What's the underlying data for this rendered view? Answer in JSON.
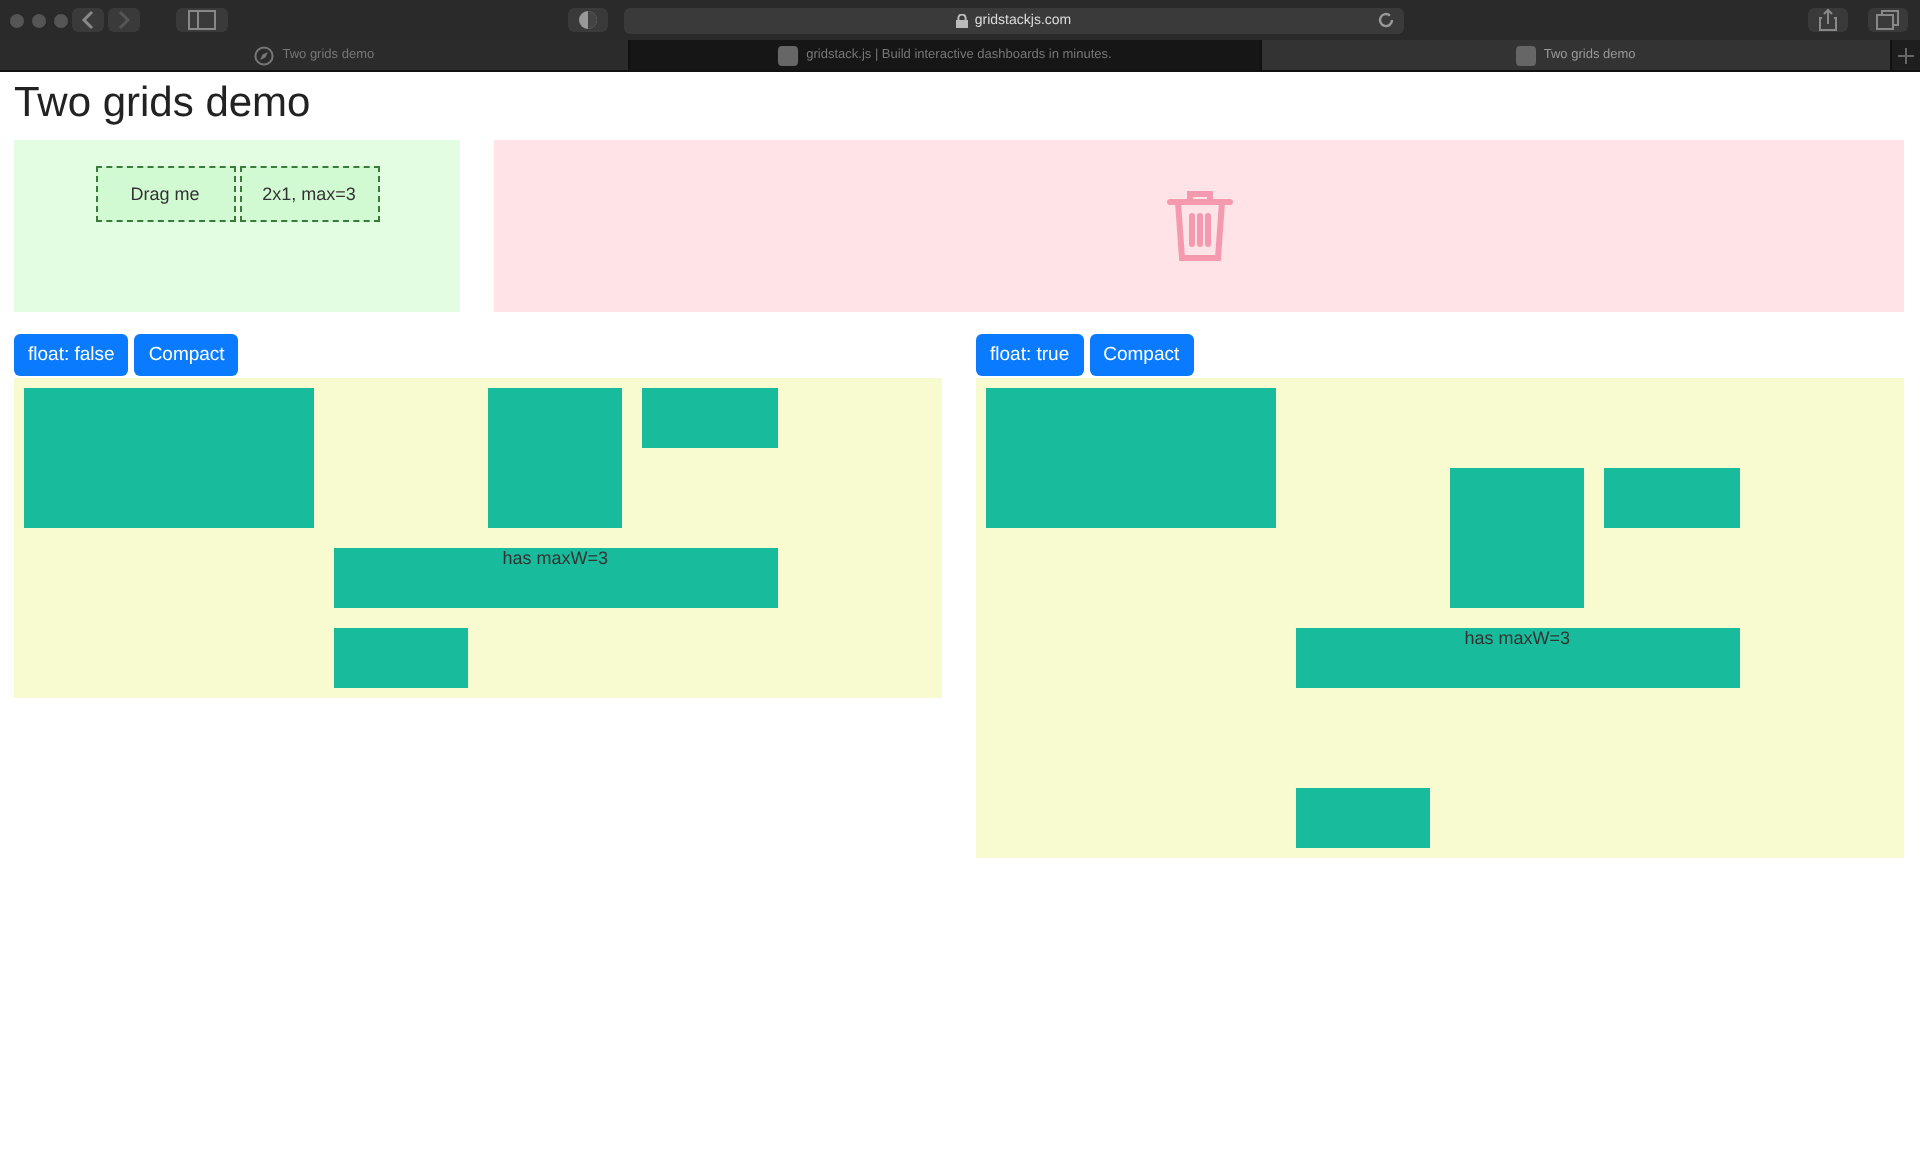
{
  "browser": {
    "address": "gridstackjs.com",
    "tabs": [
      {
        "label": "Two grids demo",
        "selected": false
      },
      {
        "label": "gridstack.js | Build interactive dashboards in minutes.",
        "selected": false
      },
      {
        "label": "Two grids demo",
        "selected": true
      }
    ]
  },
  "title": "Two grids demo",
  "sidebar": {
    "items": [
      "Drag me",
      "2x1, max=3"
    ]
  },
  "grids": [
    {
      "buttons": [
        "float: false",
        "Compact"
      ],
      "items": [
        {
          "kind": "widget"
        },
        {
          "kind": "widget"
        },
        {
          "kind": "widget"
        },
        {
          "kind": "widget",
          "label": "has maxW=3"
        },
        {
          "kind": "widget"
        }
      ]
    },
    {
      "buttons": [
        "float: true",
        "Compact"
      ],
      "items": [
        {
          "kind": "widget"
        },
        {
          "kind": "widget"
        },
        {
          "kind": "widget"
        },
        {
          "kind": "widget",
          "label": "has maxW=3"
        },
        {
          "kind": "widget"
        }
      ]
    }
  ]
}
